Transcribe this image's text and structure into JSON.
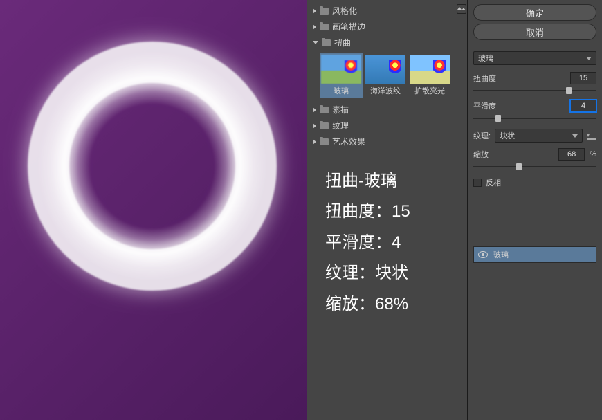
{
  "overlay": {
    "title": "扭曲-玻璃",
    "line1": "扭曲度：15",
    "line2": "平滑度：4",
    "line3": "纹理：块状",
    "line4": "缩放：68%"
  },
  "tree": {
    "categories": [
      {
        "label": "风格化",
        "expanded": false
      },
      {
        "label": "画笔描边",
        "expanded": false
      },
      {
        "label": "扭曲",
        "expanded": true
      },
      {
        "label": "素描",
        "expanded": false
      },
      {
        "label": "纹理",
        "expanded": false
      },
      {
        "label": "艺术效果",
        "expanded": false
      }
    ],
    "thumbs": [
      {
        "label": "玻璃",
        "selected": true
      },
      {
        "label": "海洋波纹",
        "selected": false
      },
      {
        "label": "扩散亮光",
        "selected": false
      }
    ]
  },
  "controls": {
    "ok_label": "确定",
    "cancel_label": "取消",
    "filter_name": "玻璃",
    "distortion_label": "扭曲度",
    "distortion_value": "15",
    "smoothness_label": "平滑度",
    "smoothness_value": "4",
    "texture_label": "纹理:",
    "texture_value": "块状",
    "zoom_label": "缩放",
    "zoom_value": "68",
    "zoom_unit": "%",
    "invert_label": "反相"
  },
  "effect_stack": {
    "item": "玻璃"
  }
}
